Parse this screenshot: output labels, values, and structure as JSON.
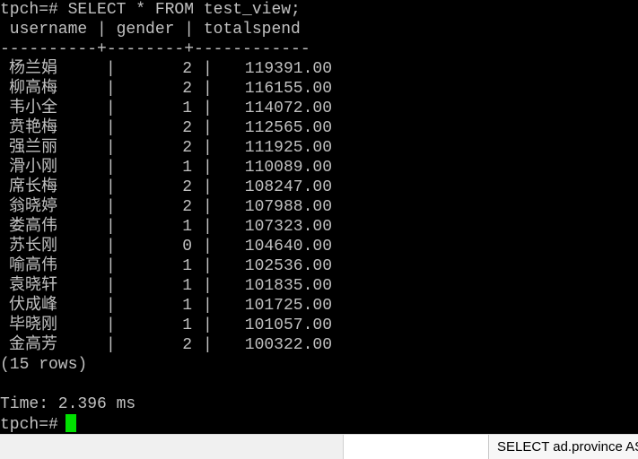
{
  "terminal": {
    "command_line": "tpch=# SELECT * FROM test_view;",
    "header_line": " username | gender | totalspend",
    "separator_line": "----------+--------+------------",
    "rows": [
      {
        "username": "杨兰娟",
        "gender": "2",
        "totalspend": "119391.00"
      },
      {
        "username": "柳高梅",
        "gender": "2",
        "totalspend": "116155.00"
      },
      {
        "username": "韦小全",
        "gender": "1",
        "totalspend": "114072.00"
      },
      {
        "username": "贲艳梅",
        "gender": "2",
        "totalspend": "112565.00"
      },
      {
        "username": "强兰丽",
        "gender": "2",
        "totalspend": "111925.00"
      },
      {
        "username": "滑小刚",
        "gender": "1",
        "totalspend": "110089.00"
      },
      {
        "username": "席长梅",
        "gender": "2",
        "totalspend": "108247.00"
      },
      {
        "username": "翁晓婷",
        "gender": "2",
        "totalspend": "107988.00"
      },
      {
        "username": "娄高伟",
        "gender": "1",
        "totalspend": "107323.00"
      },
      {
        "username": "苏长刚",
        "gender": "0",
        "totalspend": "104640.00"
      },
      {
        "username": "喻高伟",
        "gender": "1",
        "totalspend": "102536.00"
      },
      {
        "username": "袁晓轩",
        "gender": "1",
        "totalspend": "101835.00"
      },
      {
        "username": "伏成峰",
        "gender": "1",
        "totalspend": "101725.00"
      },
      {
        "username": "毕晓刚",
        "gender": "1",
        "totalspend": "101057.00"
      },
      {
        "username": "金高芳",
        "gender": "2",
        "totalspend": "100322.00"
      }
    ],
    "column_separator": "|",
    "row_count_line": "(15 rows)",
    "time_line": "Time: 2.396 ms",
    "prompt": "tpch=#",
    "colors": {
      "background": "#000000",
      "text": "#c0c0c0",
      "cursor": "#00e000"
    }
  },
  "taskbar": {
    "item_label": "SELECT ad.province AS"
  }
}
